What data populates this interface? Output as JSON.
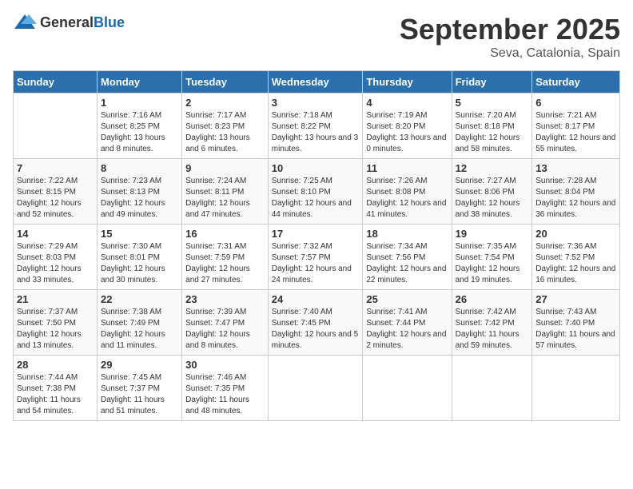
{
  "logo": {
    "general": "General",
    "blue": "Blue"
  },
  "title": "September 2025",
  "subtitle": "Seva, Catalonia, Spain",
  "days_of_week": [
    "Sunday",
    "Monday",
    "Tuesday",
    "Wednesday",
    "Thursday",
    "Friday",
    "Saturday"
  ],
  "weeks": [
    [
      {
        "day": "",
        "sunrise": "",
        "sunset": "",
        "daylight": ""
      },
      {
        "day": "1",
        "sunrise": "Sunrise: 7:16 AM",
        "sunset": "Sunset: 8:25 PM",
        "daylight": "Daylight: 13 hours and 8 minutes."
      },
      {
        "day": "2",
        "sunrise": "Sunrise: 7:17 AM",
        "sunset": "Sunset: 8:23 PM",
        "daylight": "Daylight: 13 hours and 6 minutes."
      },
      {
        "day": "3",
        "sunrise": "Sunrise: 7:18 AM",
        "sunset": "Sunset: 8:22 PM",
        "daylight": "Daylight: 13 hours and 3 minutes."
      },
      {
        "day": "4",
        "sunrise": "Sunrise: 7:19 AM",
        "sunset": "Sunset: 8:20 PM",
        "daylight": "Daylight: 13 hours and 0 minutes."
      },
      {
        "day": "5",
        "sunrise": "Sunrise: 7:20 AM",
        "sunset": "Sunset: 8:18 PM",
        "daylight": "Daylight: 12 hours and 58 minutes."
      },
      {
        "day": "6",
        "sunrise": "Sunrise: 7:21 AM",
        "sunset": "Sunset: 8:17 PM",
        "daylight": "Daylight: 12 hours and 55 minutes."
      }
    ],
    [
      {
        "day": "7",
        "sunrise": "Sunrise: 7:22 AM",
        "sunset": "Sunset: 8:15 PM",
        "daylight": "Daylight: 12 hours and 52 minutes."
      },
      {
        "day": "8",
        "sunrise": "Sunrise: 7:23 AM",
        "sunset": "Sunset: 8:13 PM",
        "daylight": "Daylight: 12 hours and 49 minutes."
      },
      {
        "day": "9",
        "sunrise": "Sunrise: 7:24 AM",
        "sunset": "Sunset: 8:11 PM",
        "daylight": "Daylight: 12 hours and 47 minutes."
      },
      {
        "day": "10",
        "sunrise": "Sunrise: 7:25 AM",
        "sunset": "Sunset: 8:10 PM",
        "daylight": "Daylight: 12 hours and 44 minutes."
      },
      {
        "day": "11",
        "sunrise": "Sunrise: 7:26 AM",
        "sunset": "Sunset: 8:08 PM",
        "daylight": "Daylight: 12 hours and 41 minutes."
      },
      {
        "day": "12",
        "sunrise": "Sunrise: 7:27 AM",
        "sunset": "Sunset: 8:06 PM",
        "daylight": "Daylight: 12 hours and 38 minutes."
      },
      {
        "day": "13",
        "sunrise": "Sunrise: 7:28 AM",
        "sunset": "Sunset: 8:04 PM",
        "daylight": "Daylight: 12 hours and 36 minutes."
      }
    ],
    [
      {
        "day": "14",
        "sunrise": "Sunrise: 7:29 AM",
        "sunset": "Sunset: 8:03 PM",
        "daylight": "Daylight: 12 hours and 33 minutes."
      },
      {
        "day": "15",
        "sunrise": "Sunrise: 7:30 AM",
        "sunset": "Sunset: 8:01 PM",
        "daylight": "Daylight: 12 hours and 30 minutes."
      },
      {
        "day": "16",
        "sunrise": "Sunrise: 7:31 AM",
        "sunset": "Sunset: 7:59 PM",
        "daylight": "Daylight: 12 hours and 27 minutes."
      },
      {
        "day": "17",
        "sunrise": "Sunrise: 7:32 AM",
        "sunset": "Sunset: 7:57 PM",
        "daylight": "Daylight: 12 hours and 24 minutes."
      },
      {
        "day": "18",
        "sunrise": "Sunrise: 7:34 AM",
        "sunset": "Sunset: 7:56 PM",
        "daylight": "Daylight: 12 hours and 22 minutes."
      },
      {
        "day": "19",
        "sunrise": "Sunrise: 7:35 AM",
        "sunset": "Sunset: 7:54 PM",
        "daylight": "Daylight: 12 hours and 19 minutes."
      },
      {
        "day": "20",
        "sunrise": "Sunrise: 7:36 AM",
        "sunset": "Sunset: 7:52 PM",
        "daylight": "Daylight: 12 hours and 16 minutes."
      }
    ],
    [
      {
        "day": "21",
        "sunrise": "Sunrise: 7:37 AM",
        "sunset": "Sunset: 7:50 PM",
        "daylight": "Daylight: 12 hours and 13 minutes."
      },
      {
        "day": "22",
        "sunrise": "Sunrise: 7:38 AM",
        "sunset": "Sunset: 7:49 PM",
        "daylight": "Daylight: 12 hours and 11 minutes."
      },
      {
        "day": "23",
        "sunrise": "Sunrise: 7:39 AM",
        "sunset": "Sunset: 7:47 PM",
        "daylight": "Daylight: 12 hours and 8 minutes."
      },
      {
        "day": "24",
        "sunrise": "Sunrise: 7:40 AM",
        "sunset": "Sunset: 7:45 PM",
        "daylight": "Daylight: 12 hours and 5 minutes."
      },
      {
        "day": "25",
        "sunrise": "Sunrise: 7:41 AM",
        "sunset": "Sunset: 7:44 PM",
        "daylight": "Daylight: 12 hours and 2 minutes."
      },
      {
        "day": "26",
        "sunrise": "Sunrise: 7:42 AM",
        "sunset": "Sunset: 7:42 PM",
        "daylight": "Daylight: 11 hours and 59 minutes."
      },
      {
        "day": "27",
        "sunrise": "Sunrise: 7:43 AM",
        "sunset": "Sunset: 7:40 PM",
        "daylight": "Daylight: 11 hours and 57 minutes."
      }
    ],
    [
      {
        "day": "28",
        "sunrise": "Sunrise: 7:44 AM",
        "sunset": "Sunset: 7:38 PM",
        "daylight": "Daylight: 11 hours and 54 minutes."
      },
      {
        "day": "29",
        "sunrise": "Sunrise: 7:45 AM",
        "sunset": "Sunset: 7:37 PM",
        "daylight": "Daylight: 11 hours and 51 minutes."
      },
      {
        "day": "30",
        "sunrise": "Sunrise: 7:46 AM",
        "sunset": "Sunset: 7:35 PM",
        "daylight": "Daylight: 11 hours and 48 minutes."
      },
      {
        "day": "",
        "sunrise": "",
        "sunset": "",
        "daylight": ""
      },
      {
        "day": "",
        "sunrise": "",
        "sunset": "",
        "daylight": ""
      },
      {
        "day": "",
        "sunrise": "",
        "sunset": "",
        "daylight": ""
      },
      {
        "day": "",
        "sunrise": "",
        "sunset": "",
        "daylight": ""
      }
    ]
  ]
}
